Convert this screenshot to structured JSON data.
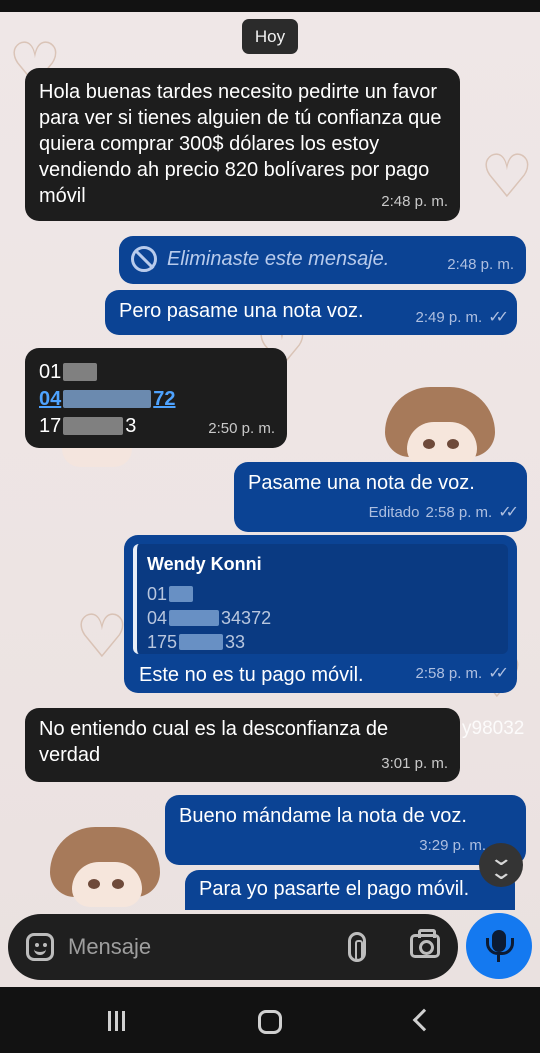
{
  "date_chip": "Hoy",
  "messages": [
    {
      "text": "Hola buenas tardes necesito pedirte un favor para ver si tienes alguien de tú confianza que quiera comprar 300$ dólares los estoy vendiendo ah precio 820 bolívares por pago móvil",
      "time": "2:48 p. m."
    },
    {
      "text": "Eliminaste este mensaje.",
      "time": "2:48 p. m."
    },
    {
      "text": "Pero pasame una nota voz.",
      "time": "2:49 p. m."
    },
    {
      "line1": "01",
      "line2_start": "04",
      "line2_end": "72",
      "line3_start": "17",
      "line3_end": "3",
      "time": "2:50 p. m."
    },
    {
      "text": "Pasame una nota de voz.",
      "edited": "Editado",
      "time": "2:58 p. m."
    },
    {
      "quote_name": "Wendy Konni",
      "quote_line1": "01",
      "quote_line2_start": "04",
      "quote_line2_end": "34372",
      "quote_line3_start": "175",
      "quote_line3_end": "33",
      "text": "Este no es tu pago móvil.",
      "time": "2:58 p. m."
    },
    {
      "text": "No entiendo cual es la desconfianza de verdad",
      "time": "3:01 p. m."
    },
    {
      "text": "Bueno mándame la nota de voz.",
      "time": "3:29 p. m."
    },
    {
      "text": "Para yo pasarte el pago móvil."
    }
  ],
  "watermark": "y98032",
  "composer": {
    "placeholder": "Mensaje"
  },
  "icons": {
    "deleted": "ban-icon",
    "read": "double-check-icon",
    "scroll": "chevron-double-down-icon",
    "sticker": "sticker-icon",
    "attach": "paperclip-icon",
    "camera": "camera-icon",
    "mic": "microphone-icon"
  },
  "colors": {
    "incoming_bubble": "#1d1d1d",
    "outgoing_bubble": "#0b4394",
    "link": "#4ea3ff",
    "mic_button": "#1479f0"
  }
}
